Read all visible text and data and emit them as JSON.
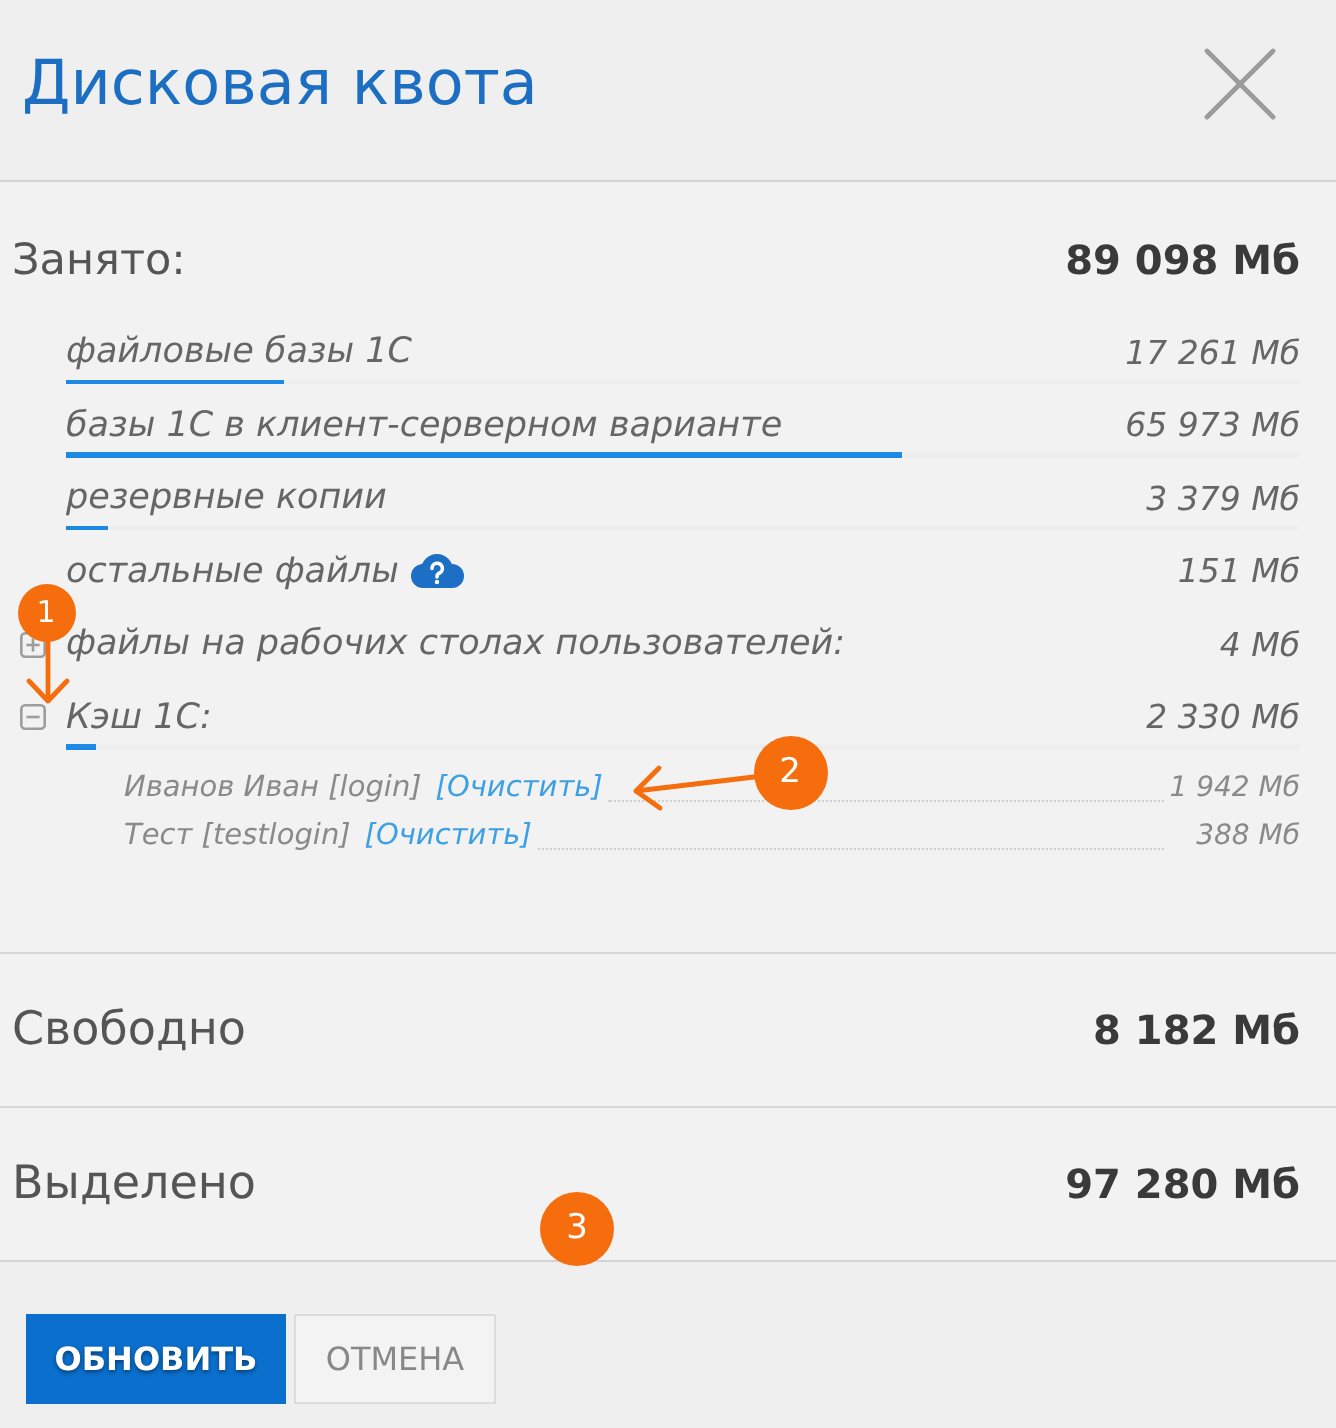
{
  "dialog": {
    "title": "Дисковая квота"
  },
  "used": {
    "label": "Занято:",
    "value": "89 098 Мб",
    "items": [
      {
        "kind": "leaf",
        "name": "файловые базы 1С",
        "value": "17 261 Мб",
        "level": 0.1774
      },
      {
        "kind": "leaf",
        "name": "базы 1С в клиент-серверном варианте",
        "value": "65 973 Мб",
        "level": 0.6782
      },
      {
        "kind": "leaf",
        "name": "резервные копии",
        "value": "3 379 Мб",
        "level": 0.0347
      },
      {
        "kind": "leaf",
        "name": "остальные файлы",
        "value": "151 Мб",
        "help_icon": true
      },
      {
        "kind": "group",
        "name": "файлы на рабочих столах пользователей:",
        "value": "4 Мб",
        "expanded": false
      },
      {
        "kind": "group",
        "name": "Кэш 1С:",
        "value": "2 330 Мб",
        "expanded": true,
        "level": 0.024,
        "callout": {
          "label": "1",
          "kind": "down"
        },
        "children": [
          {
            "name": "Иванов Иван [login]",
            "action": "[Очистить]",
            "value": "1 942 Мб",
            "callout": {
              "label": "2",
              "kind": "left"
            }
          },
          {
            "name": "Тест [testlogin]",
            "action": "[Очистить]",
            "value": "388 Мб"
          }
        ]
      }
    ]
  },
  "summary": [
    {
      "label": "Свободно",
      "value": "8 182 Мб"
    },
    {
      "label": "Выделено",
      "value": "97 280 Мб",
      "callout": {
        "label": "3",
        "kind": "plain"
      }
    }
  ],
  "buttons": [
    {
      "label": "ОБНОВИТЬ",
      "kind": "primary"
    },
    {
      "label": "ОТМЕНА",
      "kind": "secondary"
    }
  ]
}
